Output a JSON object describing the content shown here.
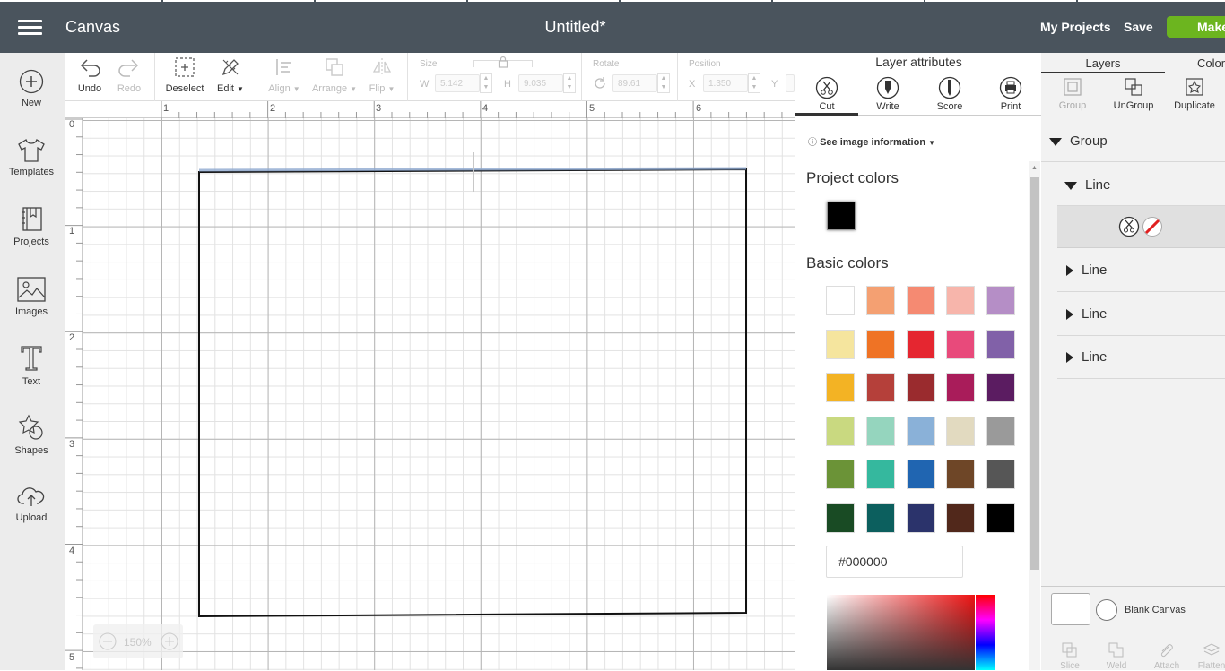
{
  "topbar": {
    "app_title": "Canvas",
    "doc_title": "Untitled*",
    "my_projects": "My Projects",
    "save": "Save",
    "make": "Make"
  },
  "sidebar": {
    "items": [
      {
        "label": "New",
        "icon": "plus-circle-icon"
      },
      {
        "label": "Templates",
        "icon": "tshirt-icon"
      },
      {
        "label": "Projects",
        "icon": "book-icon"
      },
      {
        "label": "Images",
        "icon": "image-icon"
      },
      {
        "label": "Text",
        "icon": "text-icon"
      },
      {
        "label": "Shapes",
        "icon": "shapes-icon"
      },
      {
        "label": "Upload",
        "icon": "cloud-upload-icon"
      }
    ]
  },
  "toolbar": {
    "undo": "Undo",
    "redo": "Redo",
    "deselect": "Deselect",
    "edit": "Edit",
    "align": "Align",
    "arrange": "Arrange",
    "flip": "Flip",
    "size_label": "Size",
    "w_label": "W",
    "w_value": "5.142",
    "h_label": "H",
    "h_value": "9.035",
    "rotate_label": "Rotate",
    "rotate_value": "89.61",
    "position_label": "Position",
    "x_label": "X",
    "x_value": "1.350",
    "y_label": "Y"
  },
  "ruler": {
    "h_ticks": [
      "1",
      "2",
      "3",
      "4",
      "5",
      "6"
    ],
    "v_ticks": [
      "0",
      "1",
      "2",
      "3",
      "4",
      "5"
    ]
  },
  "zoom": {
    "value": "150%"
  },
  "attributes": {
    "title": "Layer attributes",
    "tabs": [
      "Cut",
      "Write",
      "Score",
      "Print"
    ],
    "image_info": "See image information",
    "project_colors": "Project colors",
    "project_swatch": "#000000",
    "basic_colors": "Basic colors",
    "swatches": [
      "#ffffff",
      "#f4a072",
      "#f58a72",
      "#f7b5ab",
      "#b58ec6",
      "#f5e59e",
      "#ef7325",
      "#e52630",
      "#e84a7b",
      "#8161a8",
      "#f3b324",
      "#b5403a",
      "#9a2b2e",
      "#a91c5a",
      "#5b1c61",
      "#c9d980",
      "#95d5be",
      "#8ab1d8",
      "#e2dac0",
      "#9a9a9a",
      "#6b9337",
      "#35b89e",
      "#2065b1",
      "#6e4627",
      "#565656",
      "#194b24",
      "#0c5f5e",
      "#2b336b",
      "#51281b",
      "#000000"
    ],
    "hex_value": "#000000"
  },
  "layers": {
    "tab_layers": "Layers",
    "tab_color": "Color",
    "actions": [
      "Group",
      "UnGroup",
      "Duplicate"
    ],
    "group_label": "Group",
    "line_labels": [
      "Line",
      "Line",
      "Line",
      "Line"
    ],
    "blank_canvas": "Blank Canvas",
    "bottom_actions": [
      "Slice",
      "Weld",
      "Attach",
      "Flatten"
    ]
  }
}
